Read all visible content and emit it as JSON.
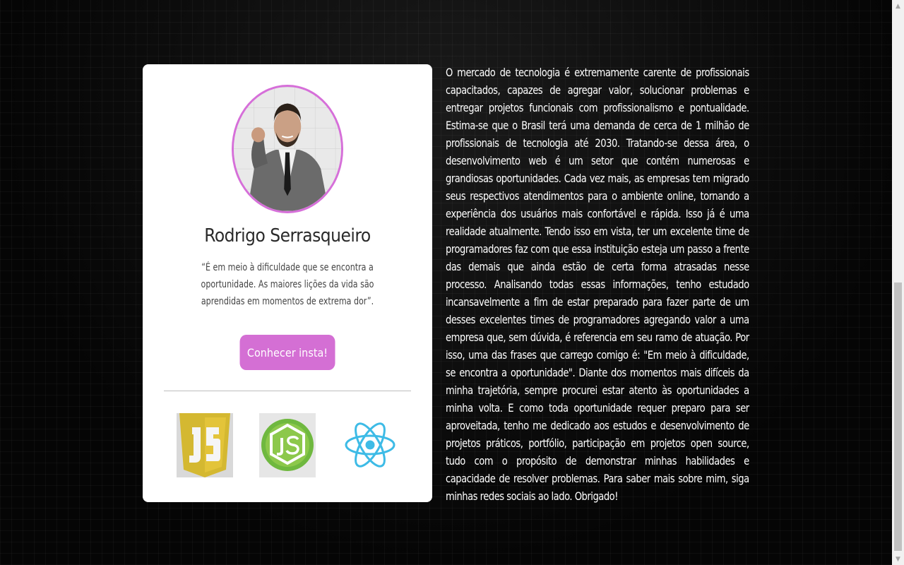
{
  "profile": {
    "name": "Rodrigo Serrasqueiro",
    "quote_lines": [
      "“É em meio à dificuldade que se encontra a",
      "oportunidade. As maiores lições da vida são",
      "aprendidas em momentos de extrema dor”."
    ],
    "cta_label": "Conhecer insta!",
    "accent": "#d66fd9"
  },
  "tech_icons": [
    "javascript-icon",
    "nodejs-icon",
    "react-icon"
  ],
  "about": {
    "text": "O mercado de tecnologia é extremamente carente de profissionais capacitados, capazes de agregar valor, solucionar problemas e entregar projetos funcionais com profissionalismo e pontualidade. Estima-se que o Brasil terá uma demanda de cerca de 1 milhão de profissionais de tecnologia até 2030. Tratando-se dessa área, o desenvolvimento web é um setor que contém numerosas e grandiosas oportunidades. Cada vez mais, as empresas tem migrado seus respectivos atendimentos para o ambiente online, tornando a experiência dos usuários mais confortável e rápida. Isso já é uma realidade atualmente. Tendo isso em vista, ter um excelente time de programadores faz com que essa instituição esteja um passo a frente das demais que ainda estão de certa forma atrasadas nesse processo. Analisando todas essas informações, tenho estudado incansavelmente a fim de estar preparado para fazer parte de um desses excelentes times de programadores agregando valor a uma empresa que, sem dúvida, é referencia em seu ramo de atuação. Por isso, uma das frases que carrego comigo é: \"Em meio à dificuldade, se encontra a oportunidade\". Diante dos momentos mais difíceis da minha trajetória, sempre procurei estar atento às oportunidades a minha volta. E como toda oportunidade requer preparo para ser aproveitada, tenho me dedicado aos estudos e desenvolvimento de projetos práticos, portfólio, participação em projetos open source, tudo com o propósito de demonstrar minhas habilidades e capacidade de resolver problemas. Para saber mais sobre mim, siga minhas redes sociais ao lado. Obrigado!"
  },
  "scrollbar": {
    "up_glyph": "▲",
    "down_glyph": "▼"
  }
}
